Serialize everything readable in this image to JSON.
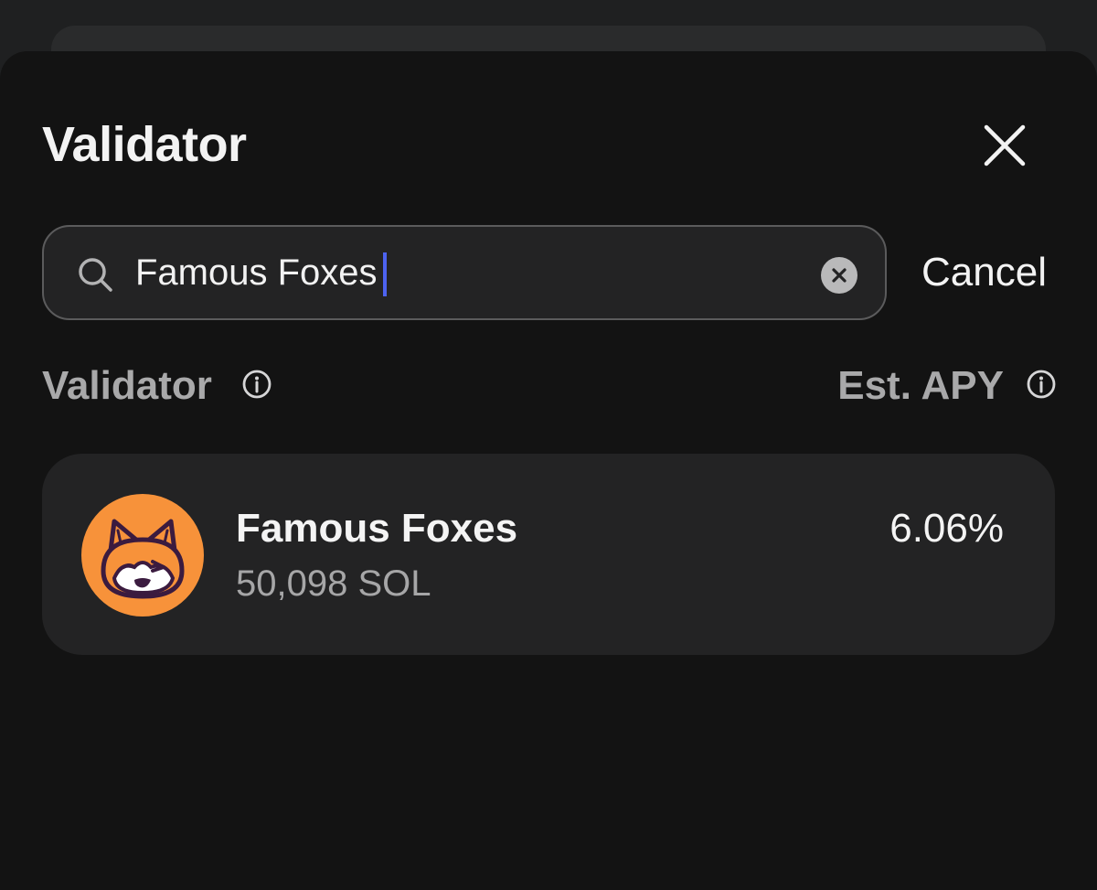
{
  "colors": {
    "sheet_bg": "#131313",
    "card_bg": "#232324",
    "accent_caret": "#4d63f0",
    "avatar_bg": "#f7923a",
    "muted_text": "#a9a9aa"
  },
  "sheet": {
    "title": "Validator",
    "close_icon": "close-icon"
  },
  "search": {
    "value": "Famous Foxes",
    "placeholder": "",
    "search_icon": "search-icon",
    "clear_icon": "clear-icon",
    "cancel_label": "Cancel"
  },
  "columns": {
    "validator_label": "Validator",
    "apy_label": "Est. APY",
    "info_icon": "info-icon"
  },
  "results": [
    {
      "name": "Famous Foxes",
      "stake": "50,098 SOL",
      "apy": "6.06%",
      "avatar_icon": "fox-avatar-icon"
    }
  ]
}
